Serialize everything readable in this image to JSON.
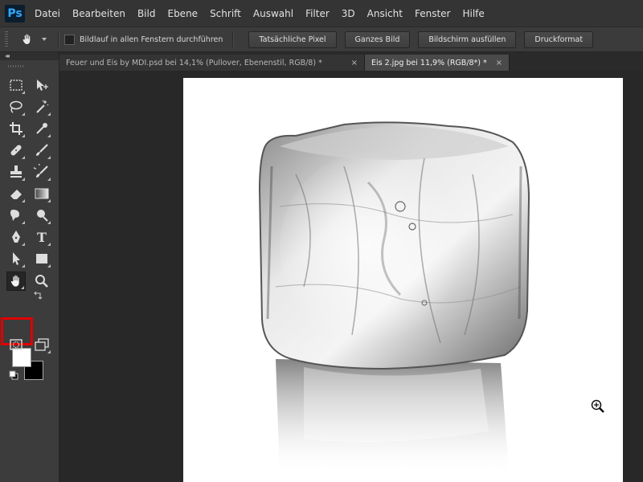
{
  "app": {
    "logo": "Ps"
  },
  "menu": [
    "Datei",
    "Bearbeiten",
    "Bild",
    "Ebene",
    "Schrift",
    "Auswahl",
    "Filter",
    "3D",
    "Ansicht",
    "Fenster",
    "Hilfe"
  ],
  "options": {
    "scroll_all_label": "Bildlauf in allen Fenstern durchführen",
    "scroll_all_checked": false,
    "buttons": [
      "Tatsächliche Pixel",
      "Ganzes Bild",
      "Bildschirm ausfüllen",
      "Druckformat"
    ]
  },
  "tabs": [
    {
      "label": "Feuer und Eis by MDI.psd bei 14,1% (Pullover, Ebenenstil, RGB/8) *",
      "close": "×",
      "active": false
    },
    {
      "label": "Eis 2.jpg bei 11,9% (RGB/8*) *",
      "close": "×",
      "active": true
    }
  ],
  "toolbar": {
    "collapse_glyph": "◂◂",
    "type_tool_glyph": "T",
    "active_tool": "hand-tool"
  },
  "colors": {
    "foreground": "#ffffff",
    "background": "#000000",
    "highlight": "#e00000",
    "accent": "#31a8ff"
  }
}
